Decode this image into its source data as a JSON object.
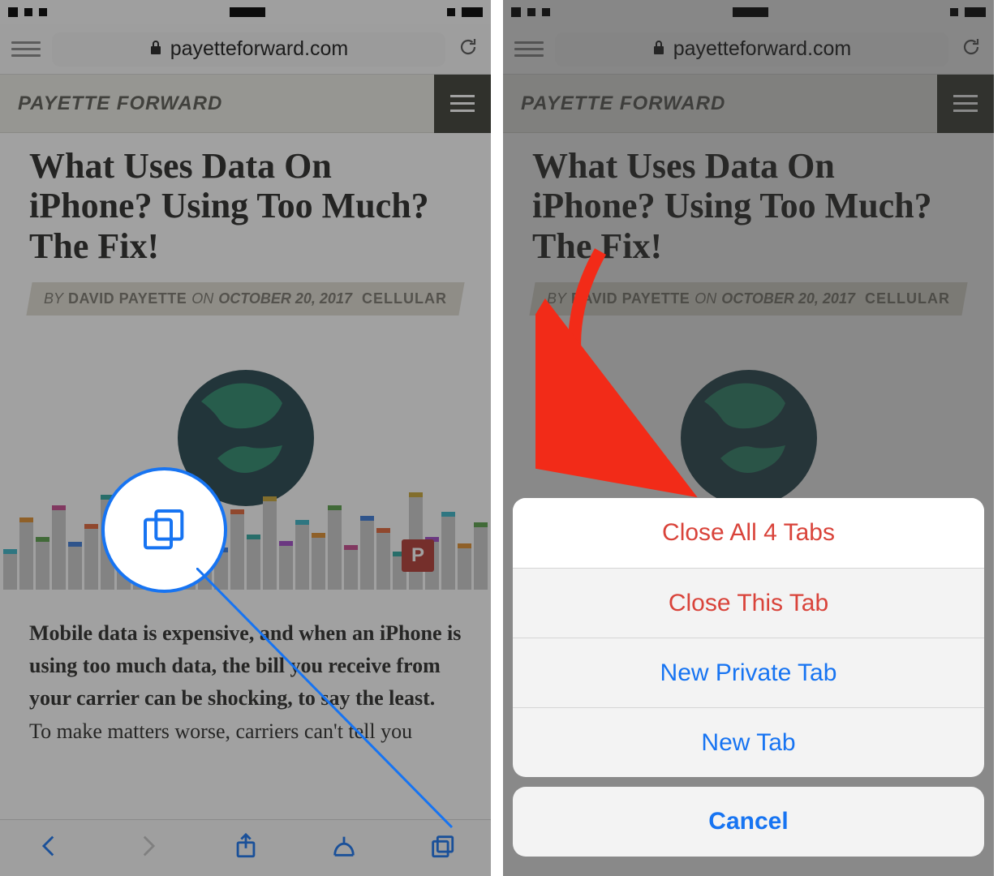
{
  "phones": {
    "left": {
      "url": "payetteforward.com",
      "site_name": "PAYETTE FORWARD",
      "article": {
        "title": "What Uses Data On iPhone? Using Too Much? The Fix!",
        "by_label": "BY",
        "author": "DAVID PAYETTE",
        "on_label": "ON",
        "date": "OCTOBER 20, 2017",
        "category": "CELLULAR",
        "badge": "P",
        "body_bold": "Mobile data is expensive, and when an iPhone is using too much data, the bill you receive from your carrier can be shocking, to say the least.",
        "body_rest": " To make matters worse, carriers can't tell you"
      }
    },
    "right": {
      "url": "payetteforward.com",
      "site_name": "PAYETTE FORWARD",
      "article": {
        "title": "What Uses Data On iPhone? Using Too Much? The Fix!",
        "by_label": "BY",
        "author": "DAVID PAYETTE",
        "on_label": "ON",
        "date": "OCTOBER 20, 2017",
        "category": "CELLULAR"
      },
      "sheet": {
        "close_all": "Close All 4 Tabs",
        "close_this": "Close This Tab",
        "new_private": "New Private Tab",
        "new_tab": "New Tab",
        "cancel": "Cancel"
      }
    }
  }
}
